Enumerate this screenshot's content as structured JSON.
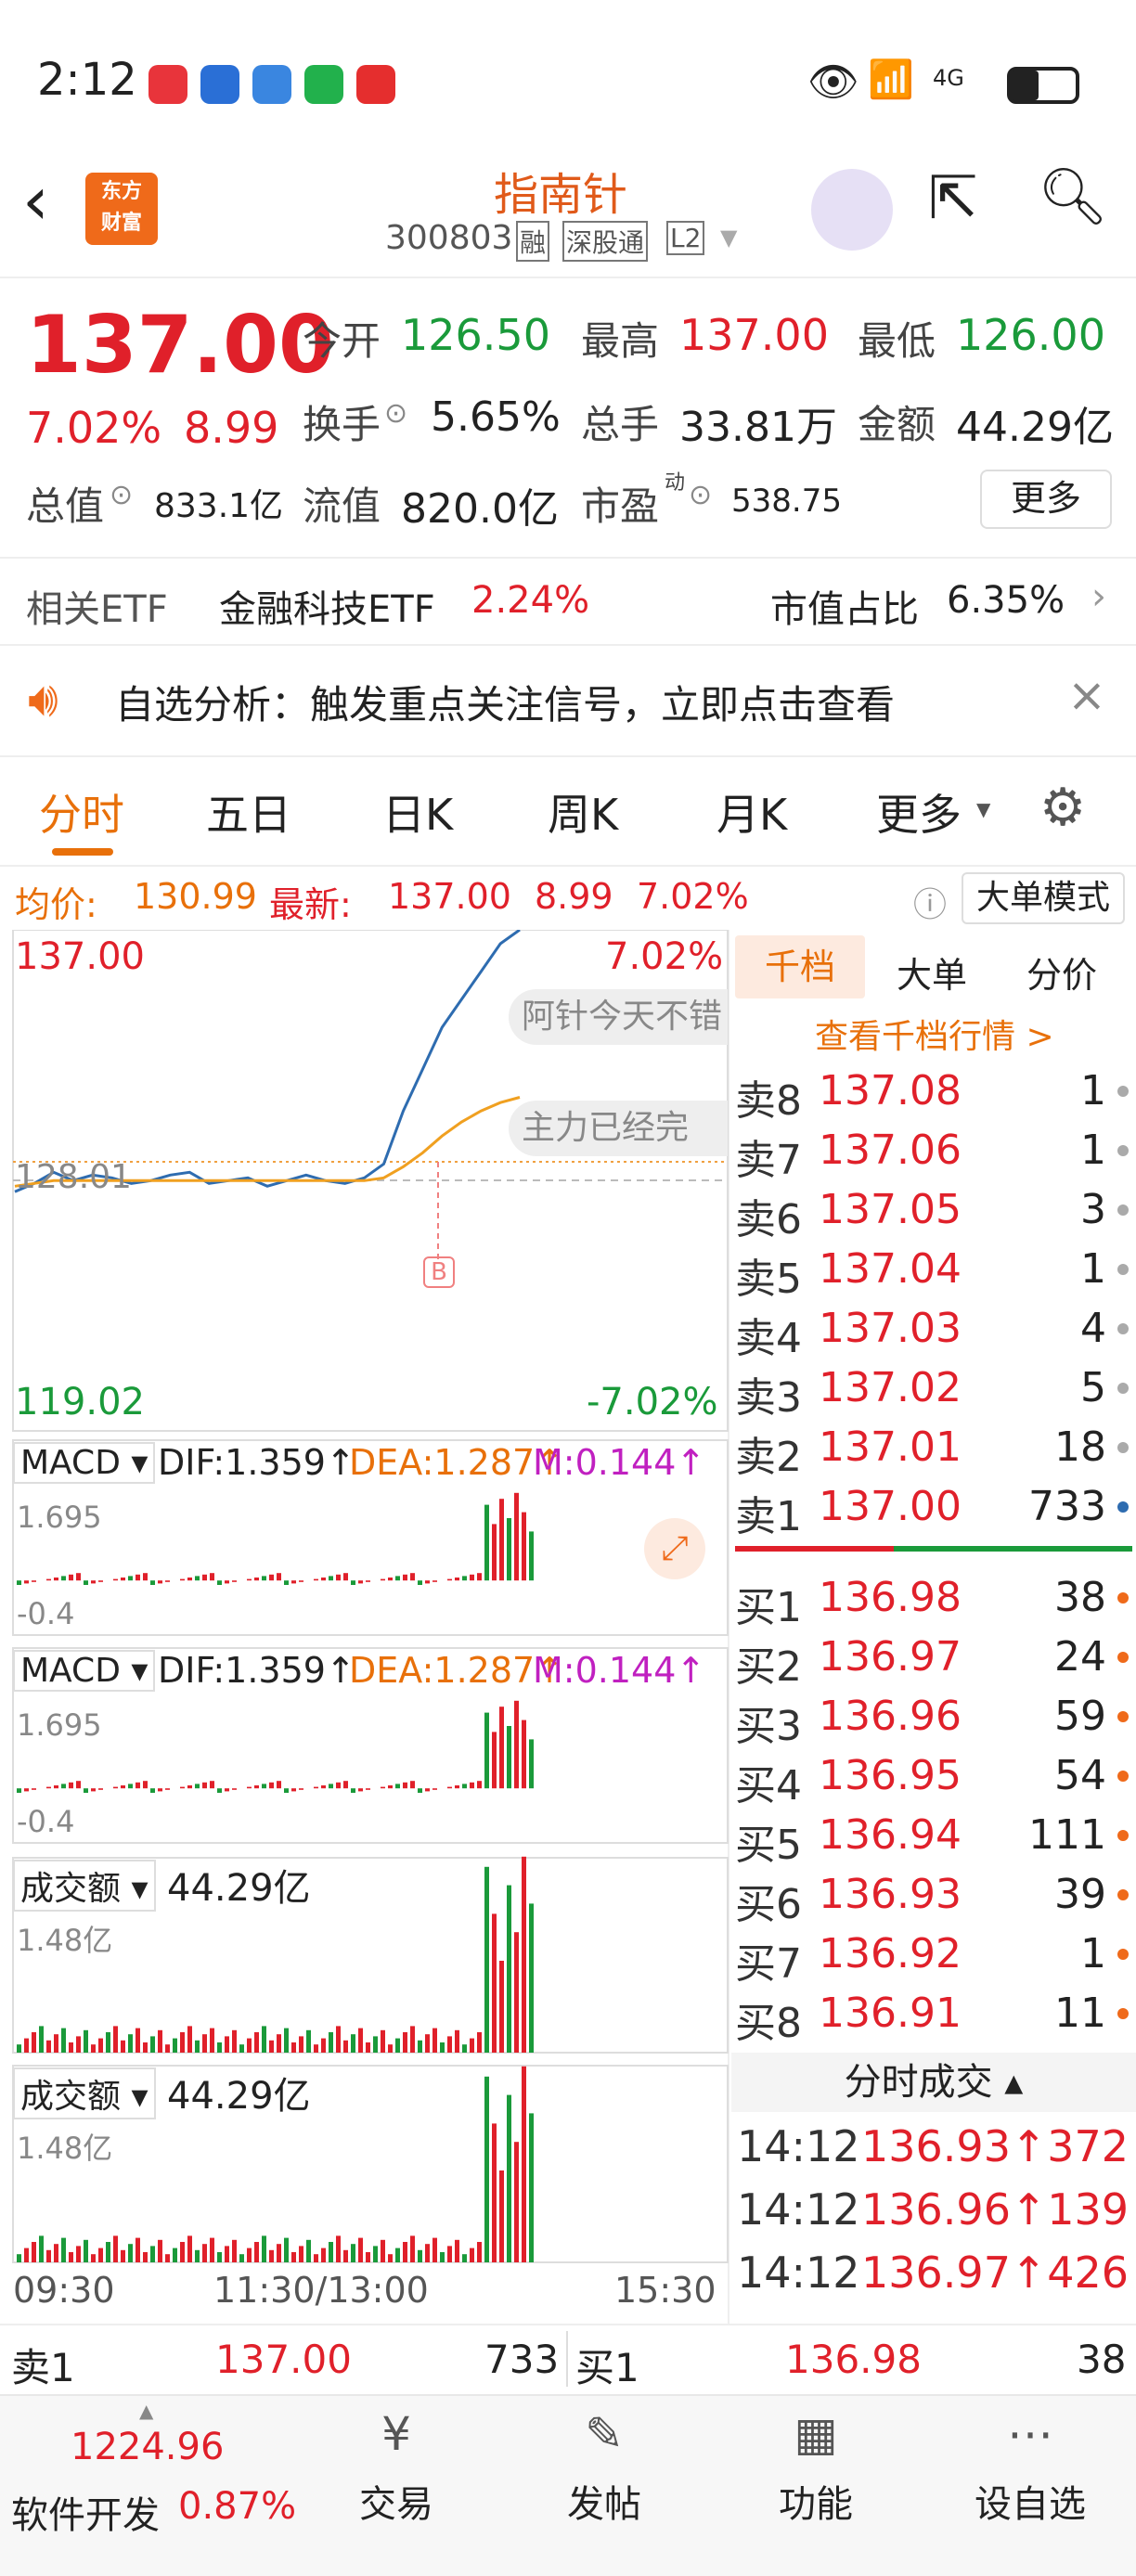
{
  "status": {
    "time": "2:12",
    "network": "4G"
  },
  "header": {
    "title": "指南针",
    "code": "300803",
    "tag1": "融",
    "tag2": "深股通",
    "tag3": "L2",
    "logo_line1": "东方",
    "logo_line2": "财富"
  },
  "quote": {
    "price": "137.00",
    "pct": "7.02%",
    "chg": "8.99",
    "open_label": "今开",
    "open": "126.50",
    "high_label": "最高",
    "high": "137.00",
    "low_label": "最低",
    "low": "126.00",
    "turnover_label": "换手",
    "turnover": "5.65%",
    "vol_label": "总手",
    "vol": "33.81万",
    "amount_label": "金额",
    "amount": "44.29亿",
    "mcap_label": "总值",
    "mcap": "833.1亿",
    "float_label": "流值",
    "float": "820.0亿",
    "pe_label": "市盈",
    "pe_sup": "动",
    "pe": "538.75",
    "more": "更多"
  },
  "etf": {
    "label": "相关ETF",
    "name": "金融科技ETF",
    "pct": "2.24%",
    "share_label": "市值占比",
    "share": "6.35%"
  },
  "notice": {
    "text": "自选分析：触发重点关注信号，立即点击查看"
  },
  "tabs": [
    "分时",
    "五日",
    "日K",
    "周K",
    "月K",
    "更多"
  ],
  "avgline": {
    "avg_label": "均价:",
    "avg": "130.99",
    "last_label": "最新:",
    "last": "137.00",
    "chg": "8.99",
    "pct": "7.02%",
    "mode": "大单模式"
  },
  "chart": {
    "top": "137.00",
    "top_pct": "7.02%",
    "mid": "128.01",
    "bottom": "119.02",
    "bottom_pct": "-7.02%",
    "ann1": "阿针今天不错",
    "ann2": "主力已经完",
    "marker": "B",
    "macd_label": "MACD",
    "dif": "DIF:1.359↑",
    "dea": "DEA:1.287↑",
    "m": "M:0.144↑",
    "macd_max": "1.695",
    "macd_min": "-0.4",
    "vol_label": "成交额",
    "vol_total": "44.29亿",
    "vol_max": "1.48亿",
    "time_start": "09:30",
    "time_mid": "11:30/13:00",
    "time_end": "15:30"
  },
  "chart_data": {
    "type": "line",
    "series": [
      {
        "name": "price",
        "values": [
          127.6,
          127.9,
          128.3,
          128.0,
          128.2,
          128.1,
          127.9,
          128.0,
          128.2,
          128.3,
          127.9,
          128.0,
          128.1,
          127.8,
          128.0,
          128.2,
          128.0,
          127.9,
          128.1,
          128.6,
          130.5,
          132.0,
          133.5,
          134.5,
          135.5,
          136.5,
          137.0
        ]
      },
      {
        "name": "avg",
        "values": [
          127.8,
          127.9,
          128.0,
          128.0,
          128.0,
          128.0,
          128.0,
          128.0,
          128.0,
          128.0,
          128.0,
          128.0,
          128.0,
          128.0,
          128.0,
          128.0,
          128.0,
          128.0,
          128.0,
          128.1,
          128.5,
          129.0,
          129.6,
          130.1,
          130.5,
          130.8,
          130.99
        ]
      }
    ],
    "ylim": [
      119.02,
      137.0
    ]
  },
  "book": {
    "tabs": [
      "千档",
      "大单",
      "分价"
    ],
    "link": "查看千档行情 >",
    "asks": [
      {
        "l": "卖8",
        "p": "137.08",
        "v": "1"
      },
      {
        "l": "卖7",
        "p": "137.06",
        "v": "1"
      },
      {
        "l": "卖6",
        "p": "137.05",
        "v": "3"
      },
      {
        "l": "卖5",
        "p": "137.04",
        "v": "1"
      },
      {
        "l": "卖4",
        "p": "137.03",
        "v": "4"
      },
      {
        "l": "卖3",
        "p": "137.02",
        "v": "5"
      },
      {
        "l": "卖2",
        "p": "137.01",
        "v": "18"
      },
      {
        "l": "卖1",
        "p": "137.00",
        "v": "733"
      }
    ],
    "bids": [
      {
        "l": "买1",
        "p": "136.98",
        "v": "38"
      },
      {
        "l": "买2",
        "p": "136.97",
        "v": "24"
      },
      {
        "l": "买3",
        "p": "136.96",
        "v": "59"
      },
      {
        "l": "买4",
        "p": "136.95",
        "v": "54"
      },
      {
        "l": "买5",
        "p": "136.94",
        "v": "111"
      },
      {
        "l": "买6",
        "p": "136.93",
        "v": "39"
      },
      {
        "l": "买7",
        "p": "136.92",
        "v": "1"
      },
      {
        "l": "买8",
        "p": "136.91",
        "v": "11"
      }
    ],
    "ticks_label": "分时成交",
    "ticks": [
      {
        "t": "14:12",
        "p": "136.93↑",
        "v": "372"
      },
      {
        "t": "14:12",
        "p": "136.96↑",
        "v": "139"
      },
      {
        "t": "14:12",
        "p": "136.97↑",
        "v": "426"
      }
    ]
  },
  "bottom_quote": {
    "sell_label": "卖1",
    "sell_price": "137.00",
    "sell_vol": "733",
    "buy_label": "买1",
    "buy_price": "136.98",
    "buy_vol": "38"
  },
  "nav": {
    "index_val": "1224.96",
    "index_name": "软件开发",
    "index_pct": "0.87%",
    "trade": "交易",
    "post": "发帖",
    "func": "功能",
    "watch": "设自选"
  }
}
